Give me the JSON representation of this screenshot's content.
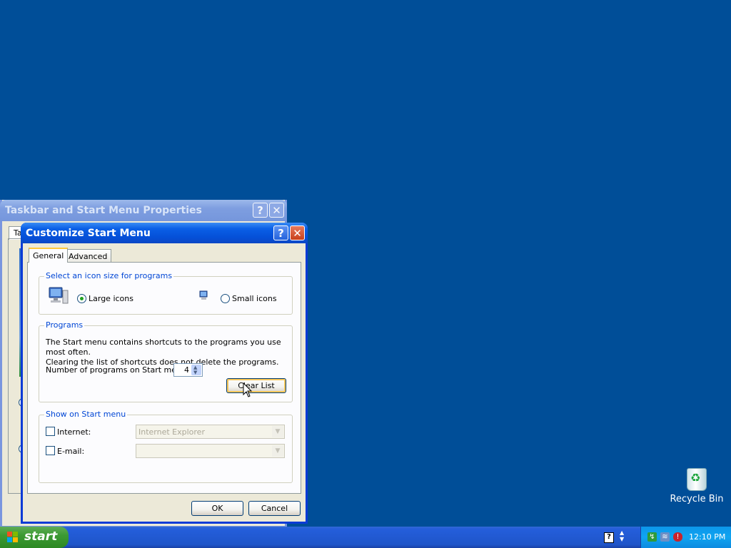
{
  "desktop": {
    "recycle_bin_label": "Recycle Bin"
  },
  "back_window": {
    "title": "Taskbar and Start Menu Properties",
    "tab_label": "Ta",
    "help": "?",
    "close": "✕"
  },
  "dialog": {
    "title": "Customize Start Menu",
    "help": "?",
    "close": "✕",
    "tabs": [
      {
        "label": "General",
        "selected": true
      },
      {
        "label": "Advanced",
        "selected": false
      }
    ],
    "icon_size": {
      "legend": "Select an icon size for programs",
      "large_label": "Large icons",
      "small_label": "Small icons",
      "selected": "large"
    },
    "programs": {
      "legend": "Programs",
      "description_line1": "The Start menu contains shortcuts to the programs you use most often.",
      "description_line2": "Clearing the list of shortcuts does not delete the programs.",
      "count_label": "Number of programs on Start menu:",
      "count_value": "4",
      "clear_button": "Clear List"
    },
    "show_on_start": {
      "legend": "Show on Start menu",
      "internet_label": "Internet:",
      "internet_checked": false,
      "internet_value": "Internet Explorer",
      "email_label": "E-mail:",
      "email_checked": false,
      "email_value": ""
    },
    "ok_button": "OK",
    "cancel_button": "Cancel"
  },
  "taskbar": {
    "start_label": "start",
    "help_glyph": "?",
    "clock": "12:10 PM"
  },
  "colors": {
    "desktop": "#004e98",
    "title_blue": "#0550d8",
    "start_green": "#3c9a33",
    "accent_label": "#0046d5"
  }
}
